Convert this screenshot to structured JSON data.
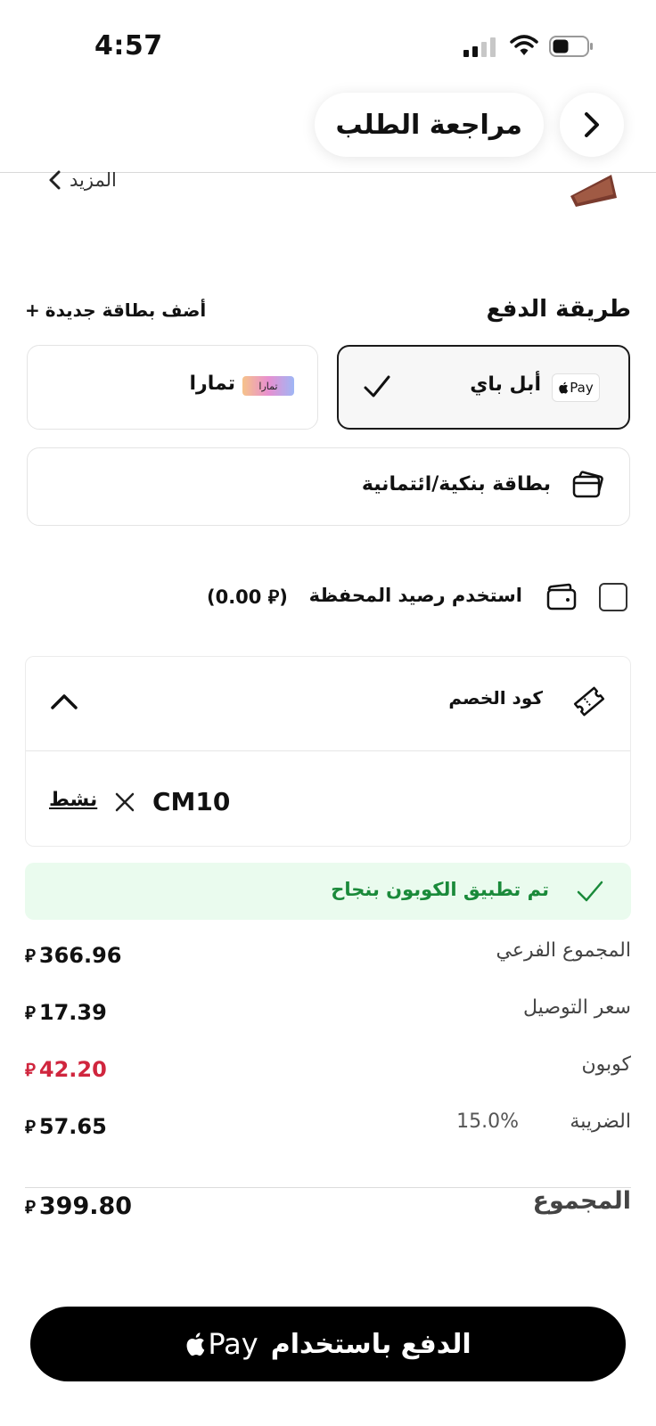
{
  "status_bar": {
    "time": "4:57"
  },
  "header": {
    "title": "مراجعة الطلب"
  },
  "product": {
    "more_label": "المزيد"
  },
  "payment": {
    "title": "طريقة الدفع",
    "add_card": "أضف بطاقة جديدة",
    "add_card_plus": "+",
    "options": [
      {
        "label": "أبل باي",
        "badge": "Pay",
        "selected": true
      },
      {
        "label": "تمارا",
        "badge": "تمارا",
        "selected": false
      },
      {
        "label": "بطاقة بنكية/ائتمانية",
        "selected": false
      }
    ]
  },
  "wallet": {
    "label": "استخدم رصيد المحفظة",
    "balance": "(0.00 ⃁)",
    "checked": false
  },
  "coupon": {
    "title": "كود الخصم",
    "code": "CM10",
    "status": "نشط",
    "success_message": "تم تطبيق الكوبون بنجاح"
  },
  "summary": {
    "currency_symbol": "⃁",
    "subtotal_label": "المجموع الفرعي",
    "subtotal_value": "366.96",
    "shipping_label": "سعر التوصيل",
    "shipping_value": "17.39",
    "coupon_label": "كوبون",
    "coupon_value": "42.20",
    "tax_label": "الضريبة",
    "tax_rate": "15.0%",
    "tax_value": "57.65",
    "total_label": "المجموع",
    "total_value": "399.80"
  },
  "pay_button": {
    "label": "الدفع باستخدام",
    "brand": "Pay"
  },
  "colors": {
    "accent": "#000000",
    "success_bg": "#eafbee",
    "success_text": "#1a8a3a",
    "discount": "#d0263e"
  }
}
